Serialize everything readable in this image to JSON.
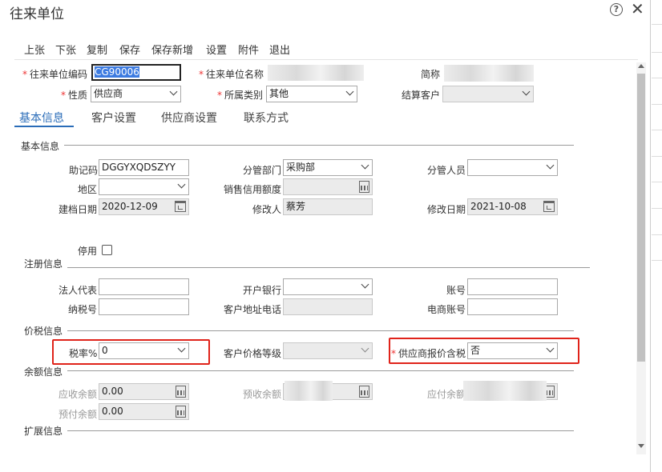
{
  "dialog": {
    "title": "往来单位"
  },
  "toolbar": {
    "prev": "上张",
    "next": "下张",
    "copy": "复制",
    "save": "保存",
    "save_new": "保存新增",
    "settings": "设置",
    "attachment": "附件",
    "exit": "退出"
  },
  "header": {
    "code_label": "往来单位编码",
    "code_value": "CG90006",
    "name_label": "往来单位名称",
    "short_label": "简称",
    "nature_label": "性质",
    "nature_value": "供应商",
    "category_label": "所属类别",
    "category_value": "其他",
    "settle_label": "结算客户"
  },
  "tabs": [
    "基本信息",
    "客户设置",
    "供应商设置",
    "联系方式"
  ],
  "basic": {
    "section": "基本信息",
    "mnemonic_label": "助记码",
    "mnemonic_value": "DGGYXQDSZYY",
    "dept_label": "分管部门",
    "dept_value": "采购部",
    "staff_label": "分管人员",
    "region_label": "地区",
    "credit_label": "销售信用额度",
    "created_label": "建档日期",
    "created_value": "2020-12-09",
    "modifier_label": "修改人",
    "modifier_value": "蔡芳",
    "modified_label": "修改日期",
    "modified_value": "2021-10-08",
    "disabled_label": "停用"
  },
  "registration": {
    "section": "注册信息",
    "legal_label": "法人代表",
    "bank_label": "开户银行",
    "account_label": "账号",
    "tax_no_label": "纳税号",
    "address_label": "客户地址电话",
    "ecommerce_label": "电商账号"
  },
  "pricing": {
    "section": "价税信息",
    "tax_rate_label": "税率%",
    "tax_rate_value": "0",
    "price_level_label": "客户价格等级",
    "supplier_tax_label": "供应商报价含税",
    "supplier_tax_value": "否"
  },
  "balance": {
    "section": "余额信息",
    "receivable_label": "应收余额",
    "receivable_value": "0.00",
    "prereceived_label": "预收余额",
    "payable_label": "应付余额",
    "prepaid_label": "预付余额",
    "prepaid_value": "0.00"
  },
  "extension": {
    "section": "扩展信息"
  },
  "colors": {
    "accent": "#2a6cb8",
    "highlight": "#e0231a",
    "required": "#ee3333"
  }
}
